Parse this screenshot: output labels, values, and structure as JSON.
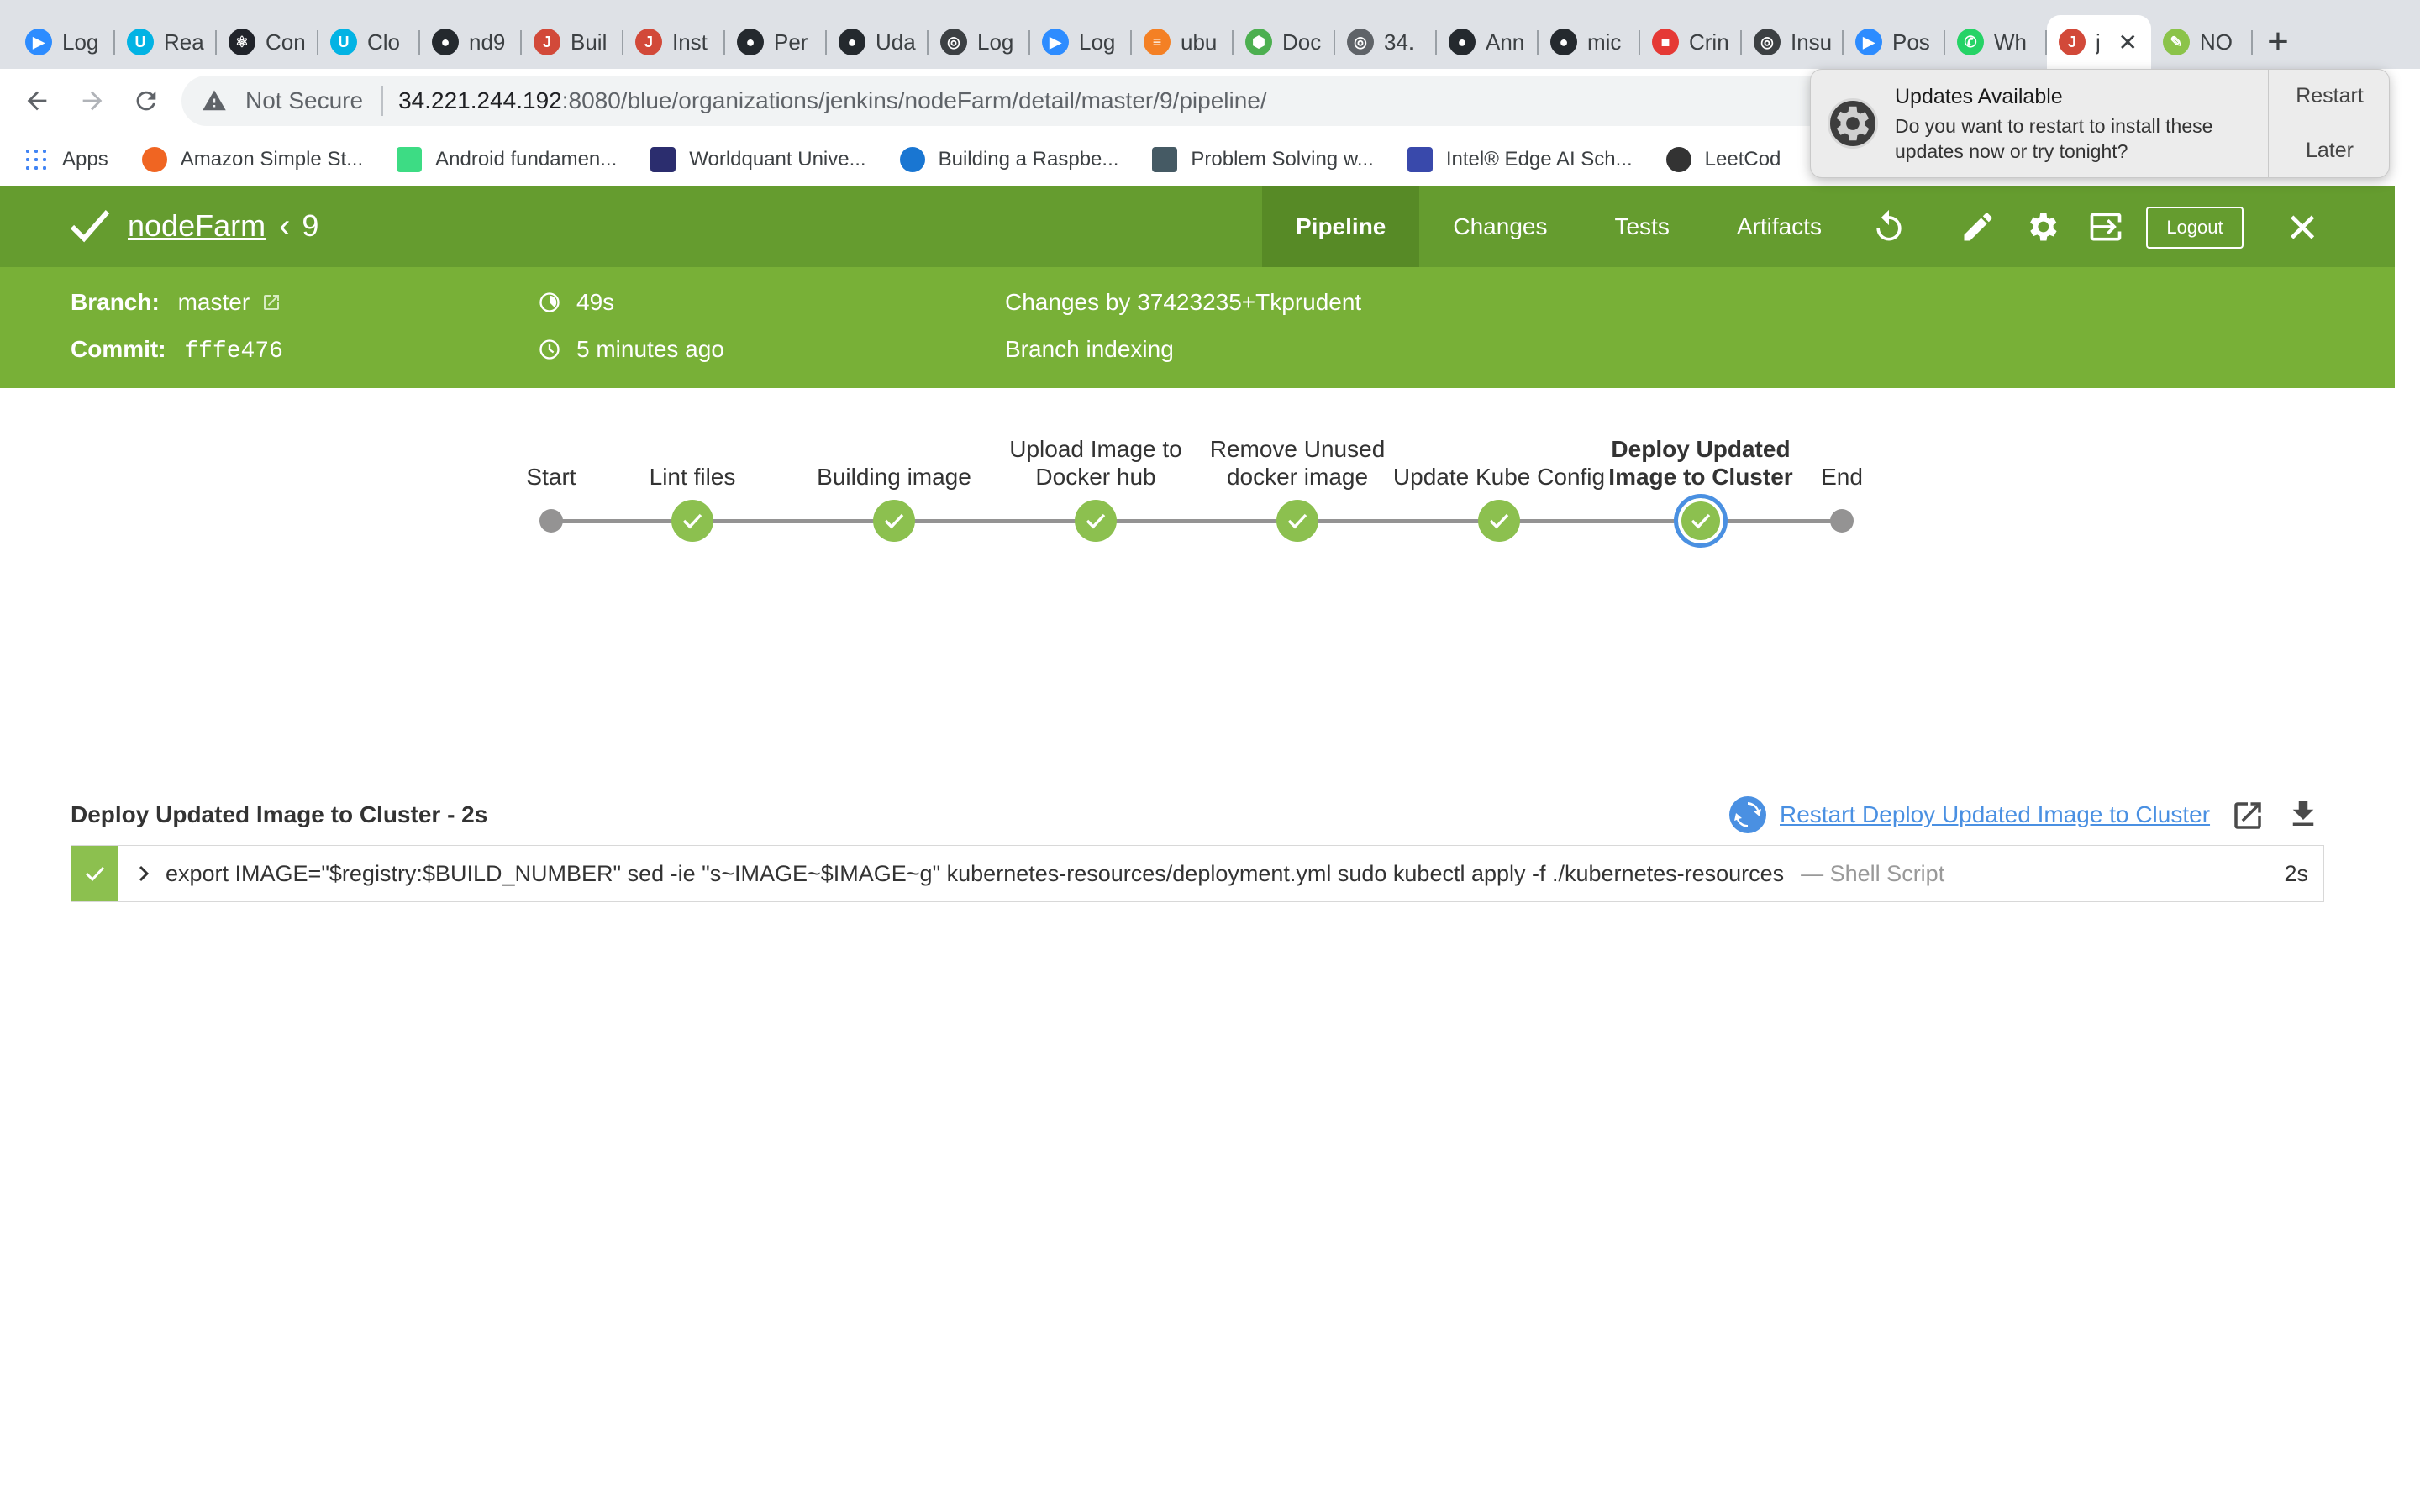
{
  "browser": {
    "tabs": [
      {
        "label": "Log",
        "color": "#2d8cff",
        "glyph": "▶"
      },
      {
        "label": "Rea",
        "color": "#02b3e4",
        "glyph": "U"
      },
      {
        "label": "Con",
        "color": "#20232a",
        "glyph": "⚛"
      },
      {
        "label": "Clo",
        "color": "#02b3e4",
        "glyph": "U"
      },
      {
        "label": "nd9",
        "color": "#24292e",
        "glyph": "●"
      },
      {
        "label": "Buil",
        "color": "#d24939",
        "glyph": "J"
      },
      {
        "label": "Inst",
        "color": "#d24939",
        "glyph": "J"
      },
      {
        "label": "Per",
        "color": "#24292e",
        "glyph": "●"
      },
      {
        "label": "Uda",
        "color": "#24292e",
        "glyph": "●"
      },
      {
        "label": "Log",
        "color": "#3c4043",
        "glyph": "◎"
      },
      {
        "label": "Log",
        "color": "#2d8cff",
        "glyph": "▶"
      },
      {
        "label": "ubu",
        "color": "#f48024",
        "glyph": "≡"
      },
      {
        "label": "Doc",
        "color": "#4caf50",
        "glyph": "⬢"
      },
      {
        "label": "34.",
        "color": "#5f6368",
        "glyph": "◎"
      },
      {
        "label": "Ann",
        "color": "#24292e",
        "glyph": "●"
      },
      {
        "label": "mic",
        "color": "#24292e",
        "glyph": "●"
      },
      {
        "label": "Crin",
        "color": "#e53935",
        "glyph": "■"
      },
      {
        "label": "Insu",
        "color": "#3c4043",
        "glyph": "◎"
      },
      {
        "label": "Pos",
        "color": "#2d8cff",
        "glyph": "▶"
      },
      {
        "label": "Wh",
        "color": "#25d366",
        "glyph": "✆"
      },
      {
        "label": "j",
        "color": "#d24939",
        "glyph": "J",
        "active": true
      },
      {
        "label": "NO",
        "color": "#8bc34a",
        "glyph": "✎"
      }
    ],
    "new_tab": "+",
    "active_tab_close": "✕",
    "security_label": "Not Secure",
    "url_host": "34.221.244.192",
    "url_path": ":8080/blue/organizations/jenkins/nodeFarm/detail/master/9/pipeline/",
    "bookmarks": [
      {
        "label": "Apps",
        "color": "#4285f4"
      },
      {
        "label": "Amazon Simple St...",
        "color": "#f06522"
      },
      {
        "label": "Android fundamen...",
        "color": "#3ddc84"
      },
      {
        "label": "Worldquant Unive...",
        "color": "#2b2d6e"
      },
      {
        "label": "Building a Raspbe...",
        "color": "#1976d2"
      },
      {
        "label": "Problem Solving w...",
        "color": "#455a64"
      },
      {
        "label": "Intel® Edge AI Sch...",
        "color": "#3949ab"
      },
      {
        "label": "LeetCod",
        "color": "#333333"
      }
    ]
  },
  "notification": {
    "title": "Updates Available",
    "body": "Do you want to restart to install these updates now or try tonight?",
    "primary": "Restart",
    "secondary": "Later"
  },
  "header": {
    "job_name": "nodeFarm",
    "build_number": "9",
    "nav": [
      "Pipeline",
      "Changes",
      "Tests",
      "Artifacts"
    ],
    "active_nav": 0,
    "logout": "Logout"
  },
  "meta": {
    "branch_label": "Branch:",
    "branch_value": "master",
    "commit_label": "Commit:",
    "commit_value": "fffe476",
    "duration": "49s",
    "time_ago": "5 minutes ago",
    "changes": "Changes by 37423235+Tkprudent",
    "cause": "Branch indexing"
  },
  "pipeline": {
    "stages": [
      {
        "label": "Start",
        "kind": "dot"
      },
      {
        "label": "Lint files",
        "kind": "ok"
      },
      {
        "label": "Building image",
        "kind": "ok"
      },
      {
        "label": "Upload Image to Docker hub",
        "kind": "ok"
      },
      {
        "label": "Remove Unused docker image",
        "kind": "ok"
      },
      {
        "label": "Update Kube Config",
        "kind": "ok"
      },
      {
        "label": "Deploy Updated Image to Cluster",
        "kind": "ok",
        "selected": true
      },
      {
        "label": "End",
        "kind": "dot"
      }
    ]
  },
  "step_detail": {
    "title": "Deploy Updated Image to Cluster - 2s",
    "restart_link": "Restart Deploy Updated Image to Cluster",
    "steps": [
      {
        "command": "export IMAGE=\"$registry:$BUILD_NUMBER\" sed -ie \"s~IMAGE~$IMAGE~g\" kubernetes-resources/deployment.yml sudo kubectl apply -f ./kubernetes-resources",
        "type": "— Shell Script",
        "duration": "2s"
      }
    ]
  },
  "colors": {
    "header_dark": "#659c2f",
    "header_light": "#78b037",
    "success": "#8cc04f",
    "selected_ring": "#4a90e2",
    "link": "#4a90e2"
  }
}
